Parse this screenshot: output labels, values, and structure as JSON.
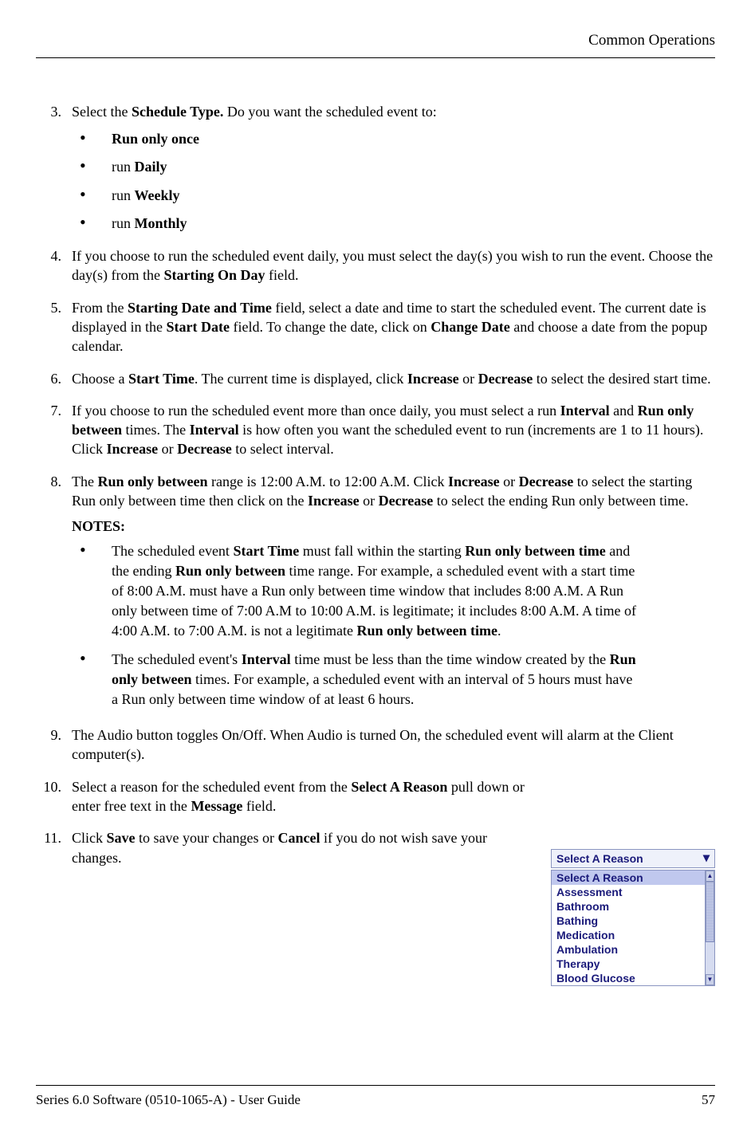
{
  "header": {
    "section": "Common Operations"
  },
  "steps": {
    "s3": {
      "prefix": "Select the ",
      "bold1": "Schedule Type.",
      "suffix": " Do you want the scheduled event to:",
      "bullets": {
        "b1": {
          "plain": "",
          "bold": "Run only once"
        },
        "b2": {
          "plain": "run ",
          "bold": "Daily"
        },
        "b3": {
          "plain": "run ",
          "bold": "Weekly"
        },
        "b4": {
          "plain": "run ",
          "bold": "Monthly"
        }
      }
    },
    "s4": {
      "t1": "If you choose to run the scheduled event daily, you must select the day(s) you wish to run the event. Choose the day(s) from the ",
      "b1": "Starting On Day",
      "t2": " field."
    },
    "s5": {
      "t1": "From the ",
      "b1": "Starting Date and Time",
      "t2": " field, select a date and time to start the scheduled event. The current date is displayed in the ",
      "b2": "Start Date",
      "t3": " field. To change the date, click on ",
      "b3": "Change Date",
      "t4": " and choose a date from the popup calendar."
    },
    "s6": {
      "t1": "Choose a ",
      "b1": "Start Time",
      "t2": ". The current time is displayed, click ",
      "b2": "Increase",
      "t3": " or ",
      "b3": "Decrease",
      "t4": " to select the desired start time."
    },
    "s7": {
      "t1": "If you choose to run the scheduled event more than once daily, you must select a run ",
      "b1": "Interval",
      "t2": " and ",
      "b2": "Run only between",
      "t3": " times. The ",
      "b3": "Interval",
      "t4": " is how often you want the scheduled event to run (increments are 1 to 11 hours). Click ",
      "b4": "Increase",
      "t5": " or ",
      "b5": "Decrease",
      "t6": " to select interval."
    },
    "s8": {
      "t1": "The ",
      "b1": "Run only between",
      "t2": " range is 12:00 A.M. to 12:00 A.M. Click ",
      "b2": "Increase",
      "t3": " or ",
      "b3": "Decrease",
      "t4": " to select the starting Run only between time then click on the ",
      "b4": "Increase",
      "t5": " or ",
      "b5": "Decrease",
      "t6": " to select the ending Run only between time.",
      "notes_label": "NOTES",
      "notes_colon": ":",
      "note1": {
        "t1": "The scheduled event ",
        "b1": "Start Time",
        "t2": " must fall within the starting ",
        "b2": "Run only between time",
        "t3": " and the ending ",
        "b3": "Run only between",
        "t4": " time range. For example, a scheduled event with a start time of 8:00 A.M. must have a Run only between time window that includes 8:00 A.M. A Run only between time of 7:00 A.M to 10:00 A.M. is legitimate; it includes 8:00 A.M. A time of 4:00 A.M. to 7:00 A.M. is not a legitimate ",
        "b4": "Run only between time",
        "t5": "."
      },
      "note2": {
        "t1": "The scheduled event's ",
        "b1": "Interval",
        "t2": " time must be less than the time window created by the ",
        "b2": "Run only between",
        "t3": " times. For example, a scheduled event with an interval of 5 hours must have a Run only between time window of at least 6 hours."
      }
    },
    "s9": {
      "t1": "The Audio button toggles On/Off. When Audio is turned On, the scheduled event will alarm at the Client computer(s)."
    },
    "s10": {
      "t1": "Select a reason for the scheduled event from the ",
      "b1": "Select A Reason",
      "t2": " pull down or enter free text in the ",
      "b2": "Message",
      "t3": " field."
    },
    "s11": {
      "t1": "Click ",
      "b1": "Save",
      "t2": " to save your changes or ",
      "b2": "Cancel",
      "t3": " if you do not wish save your changes."
    }
  },
  "dropdown": {
    "closed_label": "Select A Reason",
    "items": {
      "i0": "Select A Reason",
      "i1": "Assessment",
      "i2": "Bathroom",
      "i3": "Bathing",
      "i4": "Medication",
      "i5": "Ambulation",
      "i6": "Therapy",
      "i7": "Blood Glucose"
    }
  },
  "footer": {
    "left": "Series 6.0 Software (0510-1065-A) - User Guide",
    "right": "57"
  }
}
